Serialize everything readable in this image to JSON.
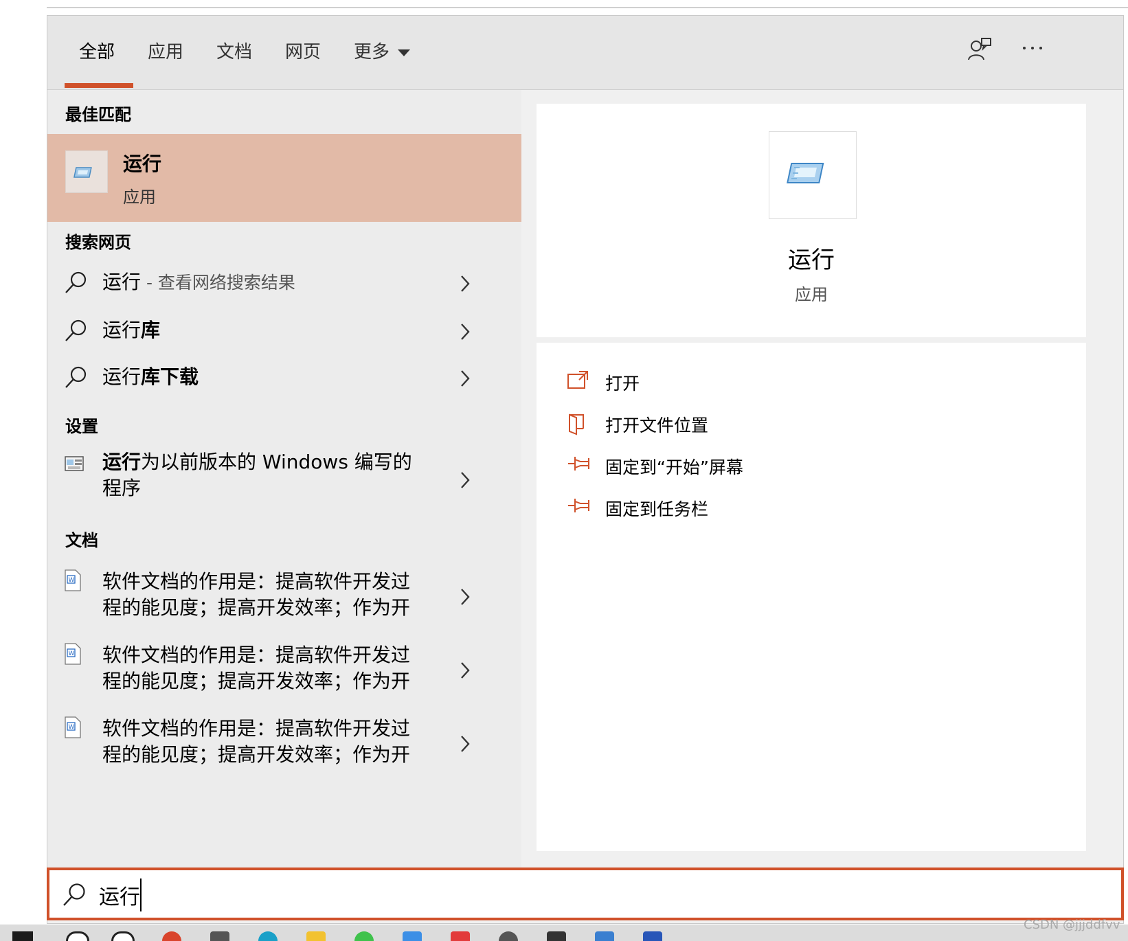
{
  "tabs": [
    {
      "label": "全部",
      "active": true
    },
    {
      "label": "应用"
    },
    {
      "label": "文档"
    },
    {
      "label": "网页"
    },
    {
      "label": "更多"
    }
  ],
  "sections": {
    "best_match": "最佳匹配",
    "search_web": "搜索网页",
    "settings": "设置",
    "documents": "文档"
  },
  "best_match": {
    "title": "运行",
    "subtitle": "应用"
  },
  "web_results": [
    {
      "prefix": "运行",
      "suffix": " - 查看网络搜索结果"
    },
    {
      "prefix": "运行",
      "bold": "库"
    },
    {
      "prefix": "运行",
      "bold": "库下载"
    }
  ],
  "settings_result": {
    "bold": "运行",
    "line1": "为以前版本的 Windows 编写的",
    "line2": "程序"
  },
  "doc_results": [
    {
      "line1": "软件文档的作用是：提高软件开发过",
      "line2": "程的能见度；提高开发效率；作为开"
    },
    {
      "line1": "软件文档的作用是：提高软件开发过",
      "line2": "程的能见度；提高开发效率；作为开"
    },
    {
      "line1": "软件文档的作用是：提高软件开发过",
      "line2": "程的能见度；提高开发效率；作为开"
    }
  ],
  "detail": {
    "title": "运行",
    "subtitle": "应用",
    "actions": [
      {
        "label": "打开",
        "icon": "open-icon"
      },
      {
        "label": "打开文件位置",
        "icon": "file-location-icon"
      },
      {
        "label": "固定到“开始”屏幕",
        "icon": "pin-icon"
      },
      {
        "label": "固定到任务栏",
        "icon": "pin-icon"
      }
    ]
  },
  "search": {
    "value": "运行"
  },
  "watermark": "CSDN @jjjddfvv",
  "colors": {
    "accent": "#d0512a",
    "selected": "#e2baa7"
  }
}
